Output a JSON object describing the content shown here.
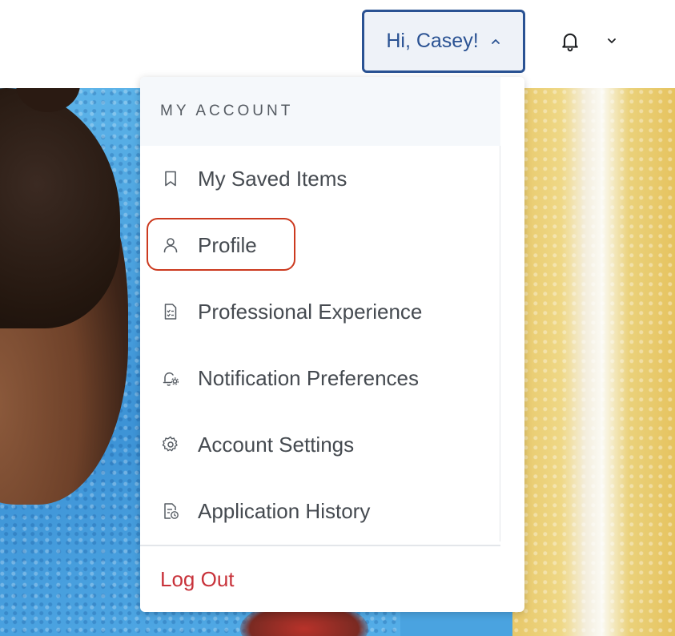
{
  "header": {
    "greeting_label": "Hi, Casey!",
    "greeting_chevron_icon": "chevron-up-icon",
    "bell_icon": "bell-icon",
    "bell_chevron_icon": "chevron-down-icon"
  },
  "menu": {
    "section_title": "MY ACCOUNT",
    "items": [
      {
        "label": "My Saved Items",
        "icon": "bookmark-icon"
      },
      {
        "label": "Profile",
        "icon": "user-icon",
        "highlighted": true
      },
      {
        "label": "Professional Experience",
        "icon": "checklist-document-icon"
      },
      {
        "label": "Notification Preferences",
        "icon": "bell-settings-icon"
      },
      {
        "label": "Account Settings",
        "icon": "gear-icon"
      },
      {
        "label": "Application History",
        "icon": "document-clock-icon"
      }
    ],
    "logout_label": "Log Out"
  },
  "colors": {
    "accent": "#2a5293",
    "highlight_outline": "#cc3a1f",
    "logout": "#c8323a"
  }
}
